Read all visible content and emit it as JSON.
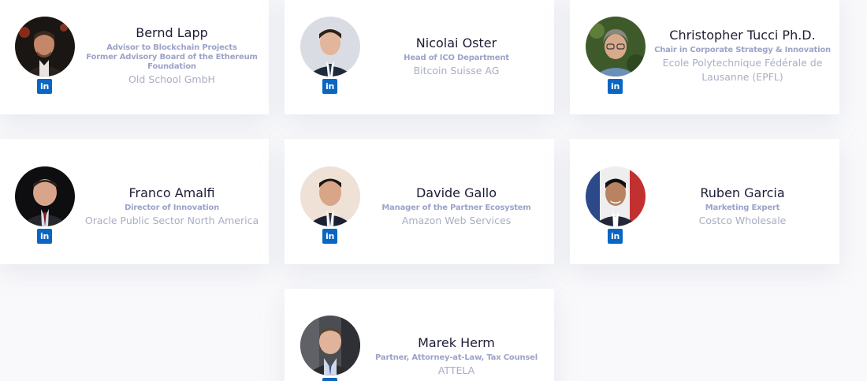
{
  "team": {
    "members": [
      {
        "name": "Bernd Lapp",
        "roles": [
          "Advisor to Blockchain Projects",
          "Former Advisory Board of the Ethereum",
          "Foundation"
        ],
        "company": [
          "Old School GmbH"
        ],
        "social": "in"
      },
      {
        "name": "Nicolai Oster",
        "roles": [
          "Head of ICO Department"
        ],
        "company": [
          "Bitcoin Suisse AG"
        ],
        "social": "in"
      },
      {
        "name": "Christopher Tucci Ph.D.",
        "roles": [
          "Chair in Corporate Strategy & Innovation"
        ],
        "company": [
          "Ecole Polytechnique Fédérale de",
          "Lausanne (EPFL)"
        ],
        "social": "in"
      },
      {
        "name": "Franco Amalfi",
        "roles": [
          "Director of Innovation"
        ],
        "company": [
          "Oracle Public Sector North America"
        ],
        "social": "in"
      },
      {
        "name": "Davide Gallo",
        "roles": [
          "Manager of the Partner Ecosystem"
        ],
        "company": [
          "Amazon Web Services"
        ],
        "social": "in"
      },
      {
        "name": "Ruben Garcia",
        "roles": [
          "Marketing Expert"
        ],
        "company": [
          "Costco Wholesale"
        ],
        "social": "in"
      },
      {
        "name": "Marek Herm",
        "roles": [
          "Partner, Attorney-at-Law, Tax Counsel"
        ],
        "company": [
          "ATTELA"
        ],
        "social": "in"
      }
    ]
  },
  "colors": {
    "name": "#1d1d35",
    "role": "#9ca3c8",
    "company": "#a9aec4",
    "linkedin": "#0a66c2",
    "card": "#ffffff",
    "background": "#f9f9fb"
  }
}
